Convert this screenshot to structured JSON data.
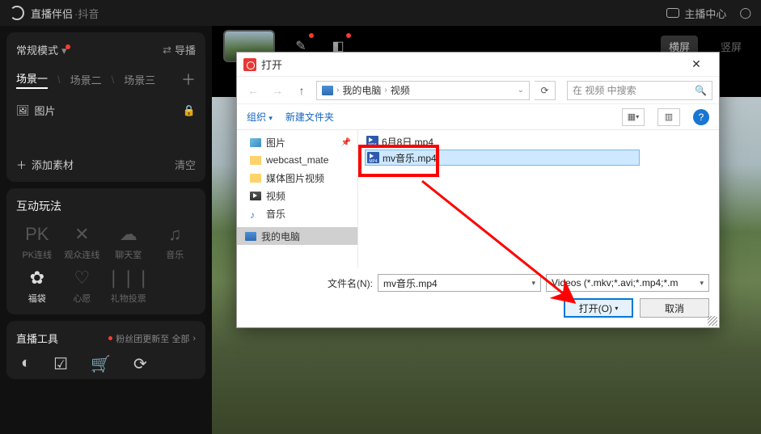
{
  "topbar": {
    "app_name": "直播伴侣",
    "app_sub": "·抖音",
    "host_center": "主播中心"
  },
  "sidebar": {
    "mode_label": "常规模式",
    "guide_label": "导播",
    "scenes": [
      "场景一",
      "场景二",
      "场景三"
    ],
    "image_label": "图片",
    "add_material": "添加素材",
    "clear_label": "清空",
    "interact_title": "互动玩法",
    "interact_items": [
      {
        "label": "PK连线",
        "icon": "PK"
      },
      {
        "label": "观众连线",
        "icon": "✕"
      },
      {
        "label": "聊天室",
        "icon": "☁"
      },
      {
        "label": "音乐",
        "icon": "♫"
      },
      {
        "label": "福袋",
        "icon": "✿"
      },
      {
        "label": "心愿",
        "icon": "♡"
      },
      {
        "label": "礼物投票",
        "icon": "❘❘❘"
      }
    ],
    "tools_title": "直播工具",
    "tools_sub": "粉丝团更新至 全部",
    "tools_arrow": "›"
  },
  "main": {
    "orient_h": "横屏",
    "orient_v": "竖屏"
  },
  "dialog": {
    "title": "打开",
    "crumb_pc": "我的电脑",
    "crumb_folder": "视频",
    "search_placeholder": "在 视频 中搜索",
    "organize": "组织",
    "new_folder": "新建文件夹",
    "tree": [
      {
        "label": "图片",
        "type": "pic",
        "pinned": true
      },
      {
        "label": "webcast_mate",
        "type": "folder"
      },
      {
        "label": "媒体图片视频",
        "type": "folder"
      },
      {
        "label": "视频",
        "type": "vid"
      },
      {
        "label": "音乐",
        "type": "music"
      },
      {
        "label": "我的电脑",
        "type": "pc",
        "selected": true
      }
    ],
    "files": [
      {
        "name": "6月8日.mp4",
        "selected": false
      },
      {
        "name": "mv音乐.mp4",
        "selected": true
      }
    ],
    "filename_label": "文件名(N):",
    "filename_value": "mv音乐.mp4",
    "filetype_value": "Videos (*.mkv;*.avi;*.mp4;*.m",
    "open_btn": "打开(O)",
    "cancel_btn": "取消"
  }
}
